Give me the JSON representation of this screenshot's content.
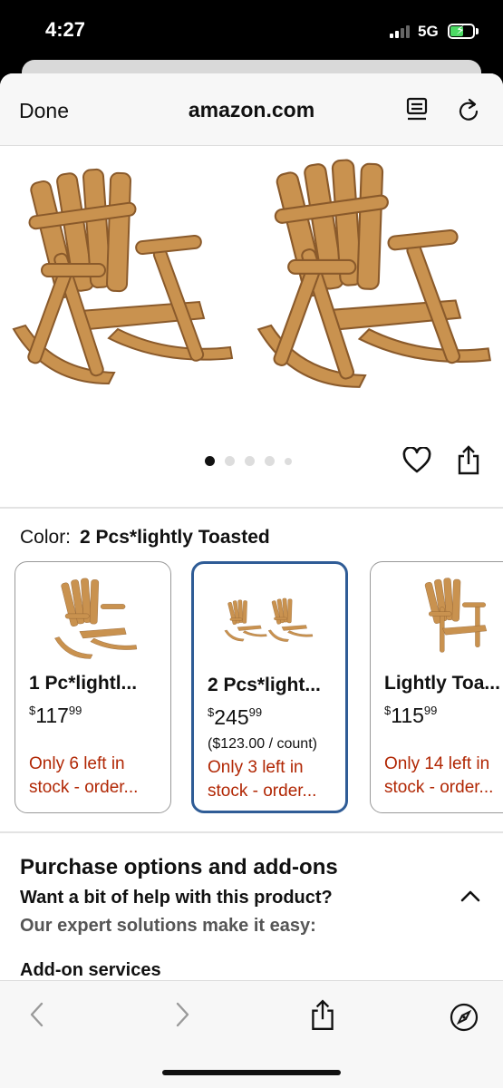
{
  "status": {
    "time": "4:27",
    "network": "5G"
  },
  "nav": {
    "done_label": "Done",
    "title": "amazon.com"
  },
  "gallery": {
    "image_count": 5,
    "active_index": 0
  },
  "color": {
    "label": "Color:",
    "selected": "2 Pcs*lightly Toasted"
  },
  "swatches": [
    {
      "title": "1 Pc*lightl...",
      "currency": "$",
      "dollars": "117",
      "cents": "99",
      "unit_price": "",
      "stock": "Only 6 left in stock - order..."
    },
    {
      "title": "2 Pcs*light...",
      "currency": "$",
      "dollars": "245",
      "cents": "99",
      "unit_price": "($123.00 / count)",
      "stock": "Only 3 left in stock - order..."
    },
    {
      "title": "Lightly Toa...",
      "currency": "$",
      "dollars": "115",
      "cents": "99",
      "unit_price": "",
      "stock": "Only 14 left in stock - order..."
    }
  ],
  "purchase": {
    "title": "Purchase options and add-ons",
    "help": "Want a bit of help with this product?",
    "subtitle": "Our expert solutions make it easy:",
    "addon": "Add-on services"
  },
  "colors": {
    "selected_border": "#2f5c96",
    "stock_text": "#b12704",
    "wood": "#c9924f"
  },
  "icons": [
    "reader-icon",
    "reload-icon",
    "heart-icon",
    "share-icon",
    "chevron-up-icon",
    "back-icon",
    "forward-icon",
    "share-icon",
    "compass-icon"
  ]
}
